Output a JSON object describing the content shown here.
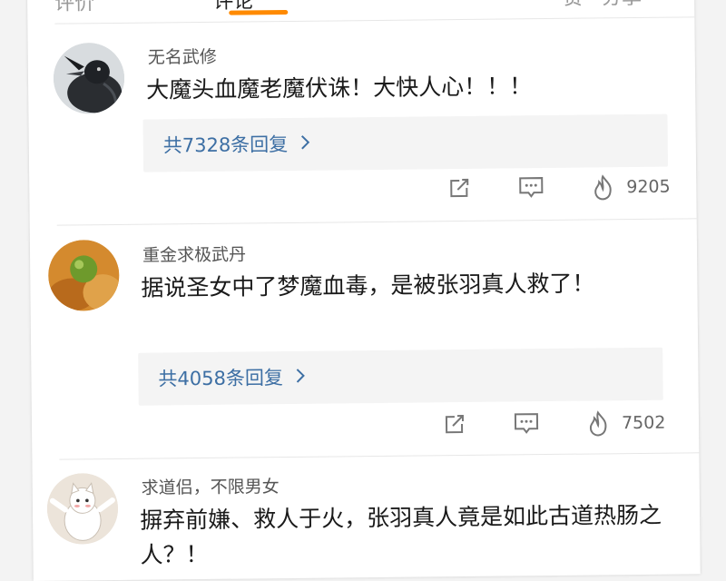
{
  "tabs": [
    "评价",
    "评论",
    "赞 · 分享"
  ],
  "comments": [
    {
      "user": "无名武修",
      "text": "大魔头血魔老魔伏诛！大快人心！！！",
      "replies": "共7328条回复",
      "likes": "9205",
      "avatar": "crow-avatar"
    },
    {
      "user": "重金求极武丹",
      "text": "据说圣女中了梦魔血毒，是被张羽真人救了！",
      "replies": "共4058条回复",
      "likes": "7502",
      "avatar": "fruit-avatar"
    },
    {
      "user": "求道侣，不限男女",
      "text": "摒弃前嫌、救人于火，张羽真人竟是如此古道热肠之人？！",
      "avatar": "cat-avatar"
    }
  ],
  "colors": {
    "accent": "#ff8a00",
    "link": "#3d6fa4",
    "reply_bg": "#f4f4f4"
  },
  "icons": [
    "share-icon",
    "comment-icon",
    "flame-icon",
    "chevron-right-icon"
  ]
}
